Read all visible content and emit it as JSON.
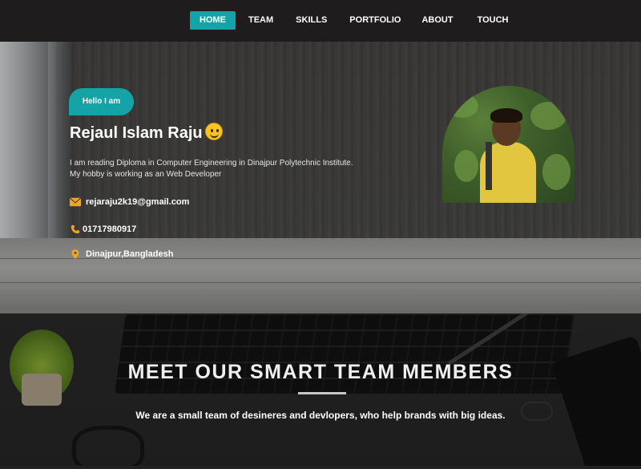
{
  "nav": {
    "items": [
      {
        "label": "HOME",
        "active": true
      },
      {
        "label": "TEAM",
        "active": false
      },
      {
        "label": "SKILLS",
        "active": false
      },
      {
        "label": "PORTFOLIO",
        "active": false
      },
      {
        "label": "ABOUT",
        "active": false
      },
      {
        "label": "TOUCH",
        "active": false
      }
    ]
  },
  "hero": {
    "greeting": "Hello I am",
    "name": "Rejaul Islam Raju",
    "bio_line1": "I am reading Diploma in Computer Engineering in Dinajpur Polytechnic Institute.",
    "bio_line2": "My hobby is working as an Web Developer",
    "email": "rejaraju2k19@gmail.com",
    "phone": "01717980917",
    "location": "Dinajpur,Bangladesh",
    "email_icon": "envelope-icon",
    "phone_icon": "phone-icon",
    "location_icon": "map-pin-icon"
  },
  "team": {
    "heading": "MEET OUR SMART TEAM MEMBERS",
    "subheading": "We are a small team of desineres and devlopers, who help brands with big ideas."
  },
  "colors": {
    "accent": "#14a3a6",
    "icon": "#f0a526",
    "nav_bg": "#1e1c1c"
  }
}
